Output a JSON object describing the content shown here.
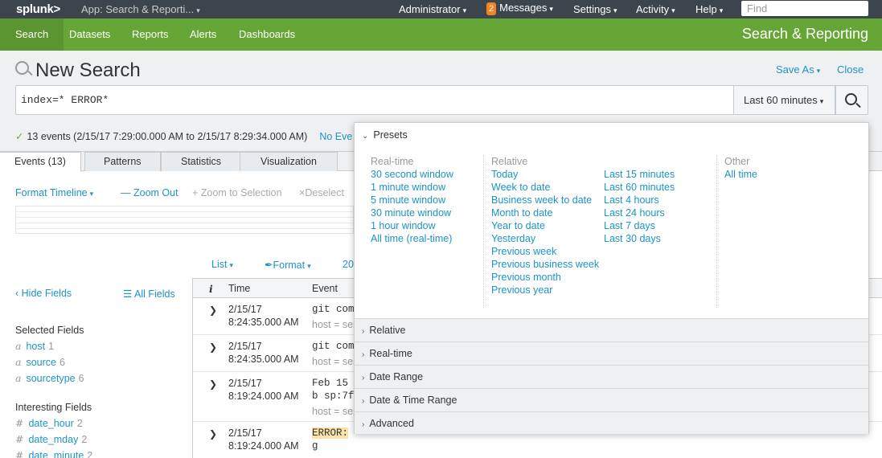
{
  "topbar": {
    "logo": "splunk>",
    "app_label": "App: Search & Reporti...",
    "user": "Administrator",
    "messages_count": "2",
    "messages": "Messages",
    "settings": "Settings",
    "activity": "Activity",
    "help": "Help",
    "find_placeholder": "Find"
  },
  "appnav": {
    "tabs": [
      "Search",
      "Datasets",
      "Reports",
      "Alerts",
      "Dashboards"
    ],
    "title": "Search & Reporting"
  },
  "header": {
    "title": "New Search",
    "save_as": "Save As",
    "close": "Close",
    "query": "index=* ERROR*",
    "time_range": "Last 60 minutes",
    "status": "13 events (2/15/17 7:29:00.000 AM to 2/15/17 8:29:34.000 AM)",
    "status_link": "No Eve"
  },
  "tabs": [
    "Events (13)",
    "Patterns",
    "Statistics",
    "Visualization"
  ],
  "timeline_toolbar": {
    "format": "Format Timeline",
    "zoom_out": "Zoom Out",
    "zoom_selection": "Zoom to Selection",
    "deselect": "Deselect"
  },
  "list_toolbar": {
    "list": "List",
    "format": "Format",
    "per_page": "20"
  },
  "fields": {
    "hide": "Hide Fields",
    "all": "All Fields",
    "selected_header": "Selected Fields",
    "selected": [
      {
        "type": "a",
        "name": "host",
        "count": "1"
      },
      {
        "type": "a",
        "name": "source",
        "count": "6"
      },
      {
        "type": "a",
        "name": "sourcetype",
        "count": "6"
      }
    ],
    "interesting_header": "Interesting Fields",
    "interesting": [
      {
        "type": "#",
        "name": "date_hour",
        "count": "2"
      },
      {
        "type": "#",
        "name": "date_mday",
        "count": "2"
      },
      {
        "type": "#",
        "name": "date_minute",
        "count": "2"
      }
    ]
  },
  "events": {
    "columns": [
      "i",
      "Time",
      "Event"
    ],
    "rows": [
      {
        "date": "2/15/17",
        "time": "8:24:35.000 AM",
        "line1": "git comm",
        "line2": "",
        "host": "host = ses"
      },
      {
        "date": "2/15/17",
        "time": "8:24:35.000 AM",
        "line1": "git comm",
        "line2": "",
        "host": "host = ses"
      },
      {
        "date": "2/15/17",
        "time": "8:19:24.000 AM",
        "line1": "Feb 15 0",
        "line2": "b sp:7ff",
        "host": "host = ses"
      },
      {
        "date": "2/15/17",
        "time": "8:19:24.000 AM",
        "line1": "ERROR:",
        "line2": "g",
        "host": ""
      }
    ]
  },
  "presets": {
    "header": "Presets",
    "realtime_header": "Real-time",
    "realtime": [
      "30 second window",
      "1 minute window",
      "5 minute window",
      "30 minute window",
      "1 hour window",
      "All time (real-time)"
    ],
    "relative_header": "Relative",
    "relative_col1": [
      "Today",
      "Week to date",
      "Business week to date",
      "Month to date",
      "Year to date",
      "Yesterday",
      "Previous week",
      "Previous business week",
      "Previous month",
      "Previous year"
    ],
    "relative_col2": [
      "Last 15 minutes",
      "Last 60 minutes",
      "Last 4 hours",
      "Last 24 hours",
      "Last 7 days",
      "Last 30 days"
    ],
    "other_header": "Other",
    "other": [
      "All time"
    ],
    "sections": [
      "Relative",
      "Real-time",
      "Date Range",
      "Date & Time Range",
      "Advanced"
    ]
  }
}
